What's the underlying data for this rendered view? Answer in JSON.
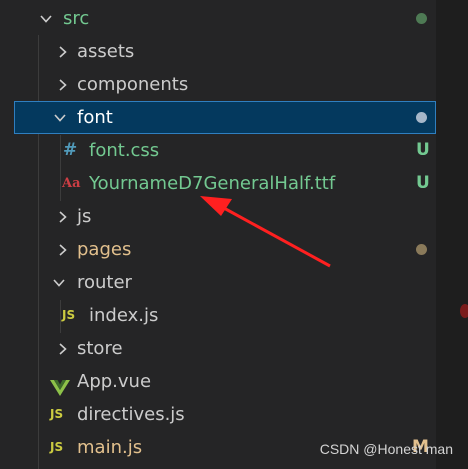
{
  "explorer": {
    "items": [
      {
        "label": "src",
        "kind": "folder-open",
        "status_dot": "#4e7a54"
      },
      {
        "label": "assets",
        "kind": "folder-closed"
      },
      {
        "label": "components",
        "kind": "folder-closed"
      },
      {
        "label": "font",
        "kind": "folder-open",
        "selected": true,
        "status_dot": "#a7b7c9"
      },
      {
        "label": "font.css",
        "kind": "css-file",
        "icon_glyph": "#",
        "status": "U"
      },
      {
        "label": "YournameD7GeneralHalf.ttf",
        "kind": "font-file",
        "icon_glyph": "Aa",
        "status": "U"
      },
      {
        "label": "js",
        "kind": "folder-closed"
      },
      {
        "label": "pages",
        "kind": "folder-closed",
        "status_dot": "#8a7a5a"
      },
      {
        "label": "router",
        "kind": "folder-open"
      },
      {
        "label": "index.js",
        "kind": "js-file",
        "icon_glyph": "JS"
      },
      {
        "label": "store",
        "kind": "folder-closed"
      },
      {
        "label": "App.vue",
        "kind": "vue-file"
      },
      {
        "label": "directives.js",
        "kind": "js-file",
        "icon_glyph": "JS"
      },
      {
        "label": "main.js",
        "kind": "js-file",
        "icon_glyph": "JS",
        "status": "M"
      }
    ]
  },
  "colors": {
    "text_default": "#cccccc",
    "text_untracked": "#73c991",
    "text_modified": "#e2c08d",
    "css_icon": "#519aba",
    "font_icon": "#cc3e44",
    "js_icon": "#cbcb41",
    "vue_icon": "#8dc149",
    "arrow": "#ff2020"
  },
  "annotation": {
    "type": "red-arrow",
    "points_to": "YournameD7GeneralHalf.ttf"
  },
  "watermark": "CSDN @Honest man"
}
